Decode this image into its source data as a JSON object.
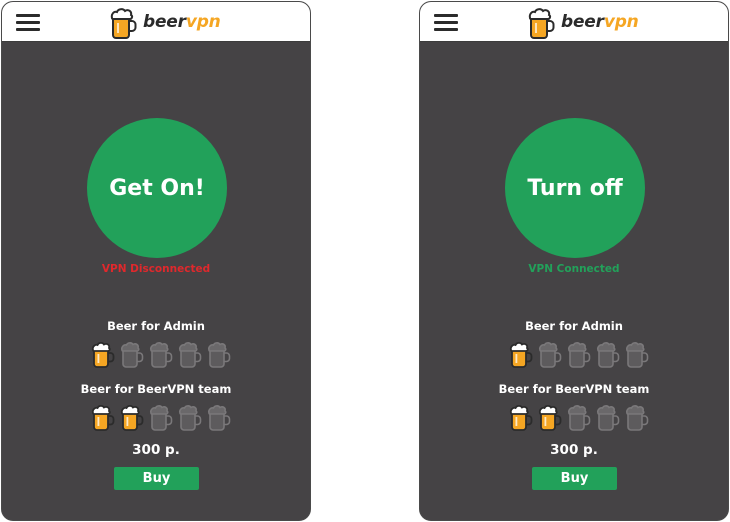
{
  "brand": {
    "name_part1": "beer",
    "name_part2": "vpn"
  },
  "colors": {
    "accent_green": "#22a15a",
    "disconnected_red": "#e0282c",
    "brand_orange": "#f5a623",
    "background_dark": "#454345"
  },
  "screens": [
    {
      "state": "disconnected",
      "button_label": "Get On!",
      "status_text": "VPN Disconnected",
      "admin_title": "Beer for Admin",
      "admin_rating": 1,
      "team_title": "Beer for BeerVPN team",
      "team_rating": 2,
      "rating_max": 5,
      "price": "300 p.",
      "buy_label": "Buy"
    },
    {
      "state": "connected",
      "button_label": "Turn off",
      "status_text": "VPN Connected",
      "admin_title": "Beer for Admin",
      "admin_rating": 1,
      "team_title": "Beer for BeerVPN team",
      "team_rating": 2,
      "rating_max": 5,
      "price": "300 p.",
      "buy_label": "Buy"
    }
  ]
}
